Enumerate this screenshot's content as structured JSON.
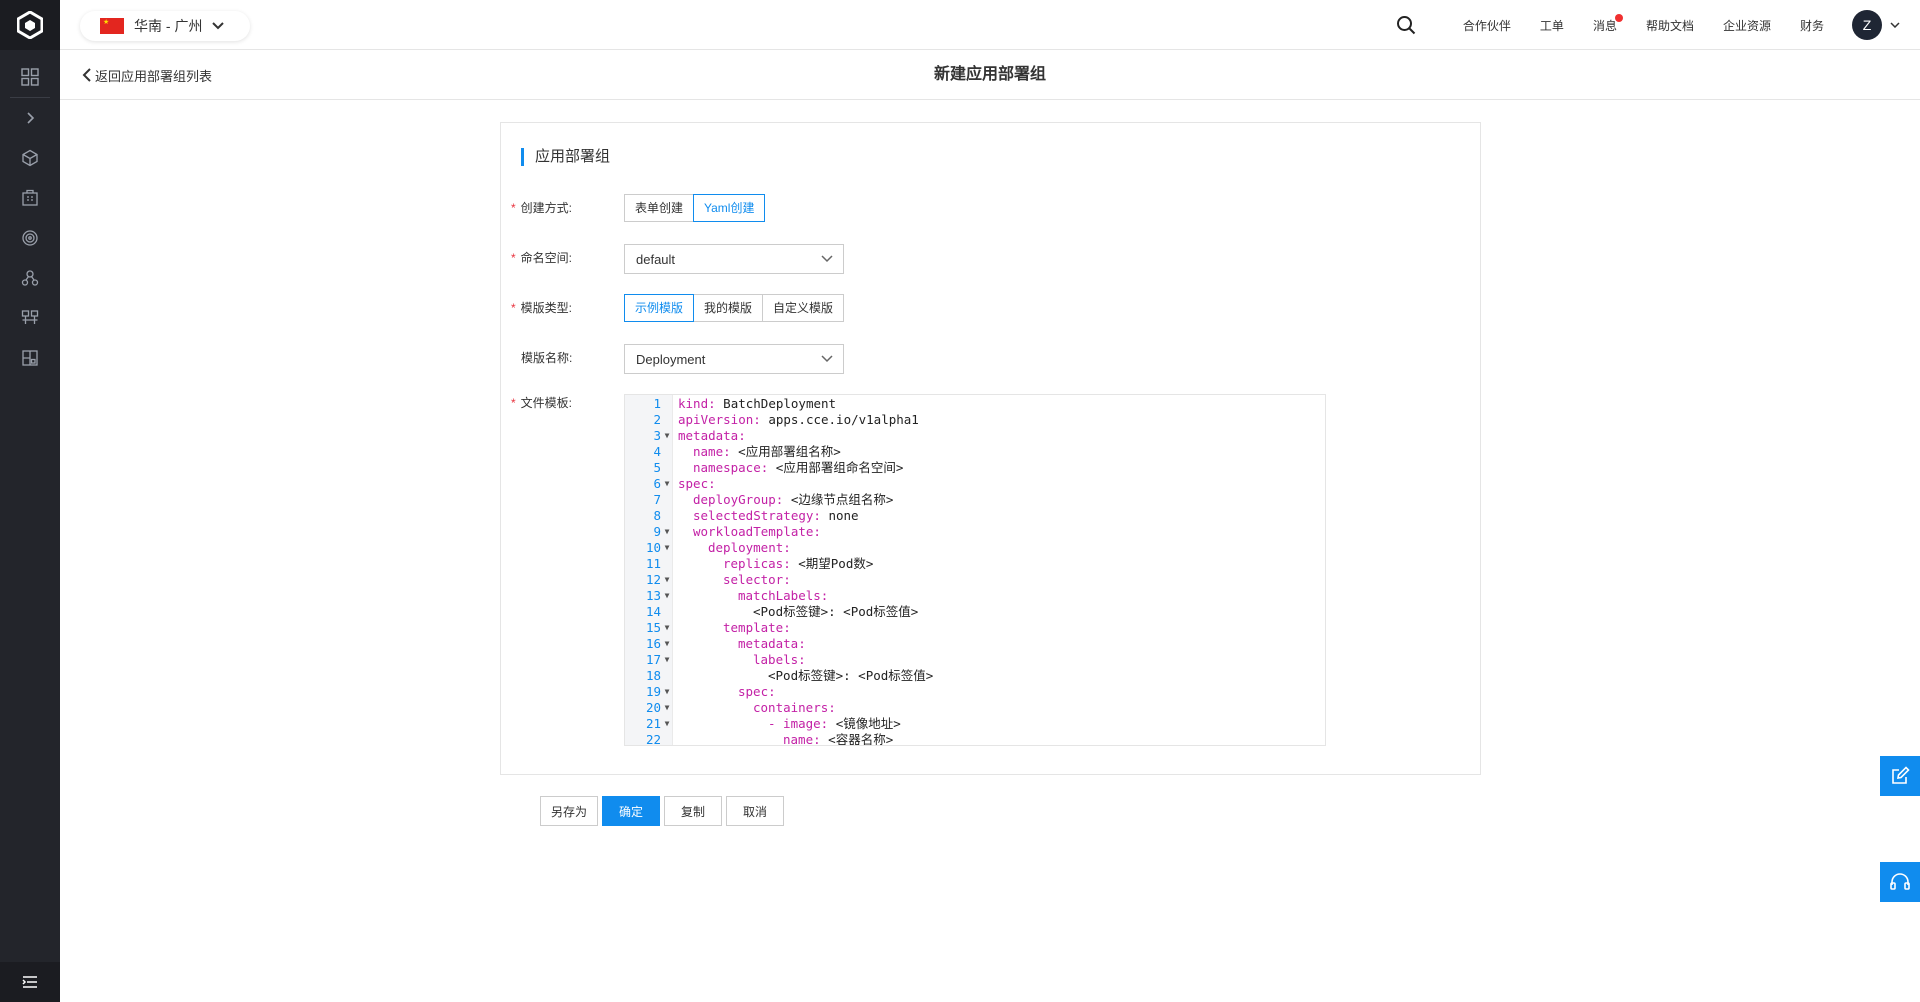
{
  "header": {
    "region_label": "华南 - 广州",
    "links": [
      "合作伙伴",
      "工单",
      "消息",
      "帮助文档",
      "企业资源",
      "财务"
    ],
    "avatar_letter": "Z"
  },
  "subheader": {
    "back_label": "返回应用部署组列表",
    "page_title": "新建应用部署组"
  },
  "form": {
    "section_title": "应用部署组",
    "create_mode": {
      "label": "创建方式:",
      "options": [
        "表单创建",
        "Yaml创建"
      ],
      "selected": "Yaml创建"
    },
    "namespace": {
      "label": "命名空间:",
      "value": "default"
    },
    "template_type": {
      "label": "模版类型:",
      "options": [
        "示例模版",
        "我的模版",
        "自定义模版"
      ],
      "selected": "示例模版"
    },
    "template_name": {
      "label": "模版名称:",
      "value": "Deployment"
    },
    "file_template": {
      "label": "文件模板:"
    }
  },
  "editor": {
    "lines": [
      {
        "n": "1",
        "fold": false,
        "indent": 0,
        "key": "kind:",
        "val": " BatchDeployment"
      },
      {
        "n": "2",
        "fold": false,
        "indent": 0,
        "key": "apiVersion:",
        "val": " apps.cce.io/v1alpha1"
      },
      {
        "n": "3",
        "fold": true,
        "indent": 0,
        "key": "metadata:",
        "val": ""
      },
      {
        "n": "4",
        "fold": false,
        "indent": 2,
        "key": "name:",
        "val": " <应用部署组名称>"
      },
      {
        "n": "5",
        "fold": false,
        "indent": 2,
        "key": "namespace:",
        "val": " <应用部署组命名空间>"
      },
      {
        "n": "6",
        "fold": true,
        "indent": 0,
        "key": "spec:",
        "val": ""
      },
      {
        "n": "7",
        "fold": false,
        "indent": 2,
        "key": "deployGroup:",
        "val": " <边缘节点组名称>"
      },
      {
        "n": "8",
        "fold": false,
        "indent": 2,
        "key": "selectedStrategy:",
        "val": " none"
      },
      {
        "n": "9",
        "fold": true,
        "indent": 2,
        "key": "workloadTemplate:",
        "val": ""
      },
      {
        "n": "10",
        "fold": true,
        "indent": 4,
        "key": "deployment:",
        "val": ""
      },
      {
        "n": "11",
        "fold": false,
        "indent": 6,
        "key": "replicas:",
        "val": " <期望Pod数>"
      },
      {
        "n": "12",
        "fold": true,
        "indent": 6,
        "key": "selector:",
        "val": ""
      },
      {
        "n": "13",
        "fold": true,
        "indent": 8,
        "key": "matchLabels:",
        "val": ""
      },
      {
        "n": "14",
        "fold": false,
        "indent": 10,
        "key": "",
        "val": "<Pod标签键>: <Pod标签值>"
      },
      {
        "n": "15",
        "fold": true,
        "indent": 6,
        "key": "template:",
        "val": ""
      },
      {
        "n": "16",
        "fold": true,
        "indent": 8,
        "key": "metadata:",
        "val": ""
      },
      {
        "n": "17",
        "fold": true,
        "indent": 10,
        "key": "labels:",
        "val": ""
      },
      {
        "n": "18",
        "fold": false,
        "indent": 12,
        "key": "",
        "val": "<Pod标签键>: <Pod标签值>"
      },
      {
        "n": "19",
        "fold": true,
        "indent": 8,
        "key": "spec:",
        "val": ""
      },
      {
        "n": "20",
        "fold": true,
        "indent": 10,
        "key": "containers:",
        "val": ""
      },
      {
        "n": "21",
        "fold": true,
        "indent": 12,
        "key": "- image:",
        "val": " <镜像地址>"
      },
      {
        "n": "22",
        "fold": false,
        "indent": 14,
        "key": "name:",
        "val": " <容器名称>"
      }
    ]
  },
  "actions": {
    "save_as": "另存为",
    "confirm": "确定",
    "copy": "复制",
    "cancel": "取消"
  },
  "colors": {
    "accent": "#108cee",
    "sidebar": "#23252b",
    "required": "#e8343f",
    "yaml_key": "#c321a6"
  }
}
